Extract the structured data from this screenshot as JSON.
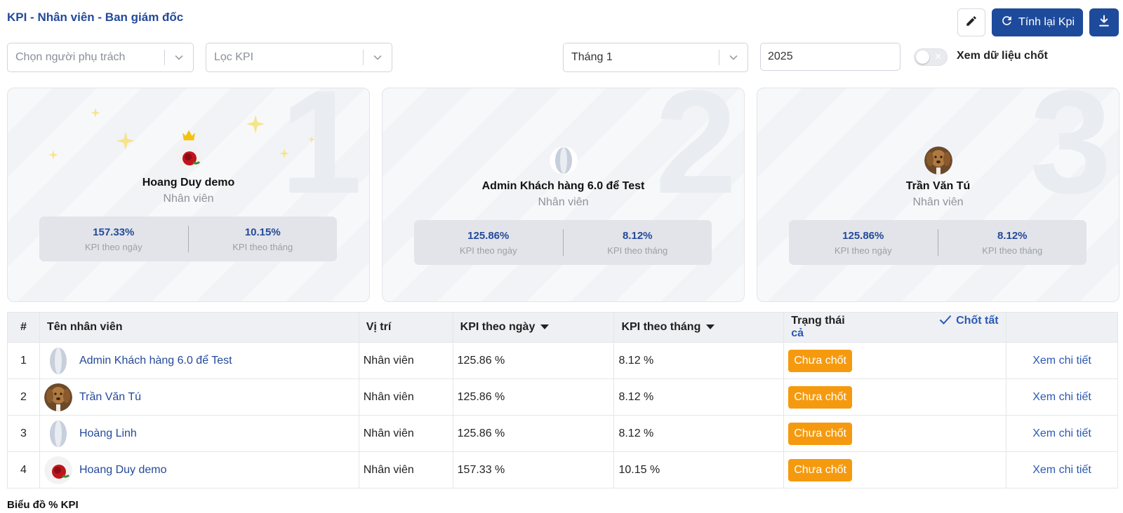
{
  "header": {
    "title": "KPI - Nhân viên - Ban giám đốc",
    "recalc_label": "Tính lại Kpi"
  },
  "filters": {
    "person_placeholder": "Chọn người phụ trách",
    "kpi_placeholder": "Lọc KPI",
    "month_value": "Tháng 1",
    "year_value": "2025",
    "locked_toggle_label": "Xem dữ liệu chốt",
    "locked_toggle_on": false
  },
  "podium": [
    {
      "rank": "1",
      "name": "Hoang Duy demo",
      "role": "Nhân viên",
      "kpi_day": "157.33%",
      "kpi_month": "10.15%",
      "kpi_day_label": "KPI theo ngày",
      "kpi_month_label": "KPI theo tháng",
      "avatar": "rose"
    },
    {
      "rank": "2",
      "name": "Admin Khách hàng 6.0 để Test",
      "role": "Nhân viên",
      "kpi_day": "125.86%",
      "kpi_month": "8.12%",
      "kpi_day_label": "KPI theo ngày",
      "kpi_month_label": "KPI theo tháng",
      "avatar": "placeholder"
    },
    {
      "rank": "3",
      "name": "Trần Văn Tú",
      "role": "Nhân viên",
      "kpi_day": "125.86%",
      "kpi_month": "8.12%",
      "kpi_day_label": "KPI theo ngày",
      "kpi_month_label": "KPI theo tháng",
      "avatar": "dog"
    }
  ],
  "table": {
    "headers": {
      "index": "#",
      "name": "Tên nhân viên",
      "position": "Vị trí",
      "kpi_day": "KPI theo ngày",
      "kpi_month": "KPI theo tháng",
      "status": "Trạng thái",
      "lock_all": "Chốt tất cả"
    },
    "rows": [
      {
        "index": "1",
        "name": "Admin Khách hàng 6.0 để Test",
        "position": "Nhân viên",
        "kpi_day": "125.86 %",
        "kpi_month": "8.12 %",
        "status": "Chưa chốt",
        "action": "Xem chi tiết",
        "avatar": "placeholder"
      },
      {
        "index": "2",
        "name": "Trần Văn Tú",
        "position": "Nhân viên",
        "kpi_day": "125.86 %",
        "kpi_month": "8.12 %",
        "status": "Chưa chốt",
        "action": "Xem chi tiết",
        "avatar": "dog"
      },
      {
        "index": "3",
        "name": "Hoàng Linh",
        "position": "Nhân viên",
        "kpi_day": "125.86 %",
        "kpi_month": "8.12 %",
        "status": "Chưa chốt",
        "action": "Xem chi tiết",
        "avatar": "placeholder"
      },
      {
        "index": "4",
        "name": "Hoang Duy demo",
        "position": "Nhân viên",
        "kpi_day": "157.33 %",
        "kpi_month": "10.15 %",
        "status": "Chưa chốt",
        "action": "Xem chi tiết",
        "avatar": "rose"
      }
    ]
  },
  "chart_section": {
    "title": "Biểu đồ % KPI"
  },
  "colors": {
    "primary": "#1e4a9c",
    "title": "#244a9a",
    "status_pending": "#f59a0f",
    "crown": "#f4c20d"
  },
  "icons": [
    "pencil-icon",
    "refresh-icon",
    "download-icon",
    "chevron-down-icon",
    "crown-icon",
    "sparkle-icon",
    "check-icon",
    "sort-desc-icon",
    "toggle-x-icon"
  ]
}
